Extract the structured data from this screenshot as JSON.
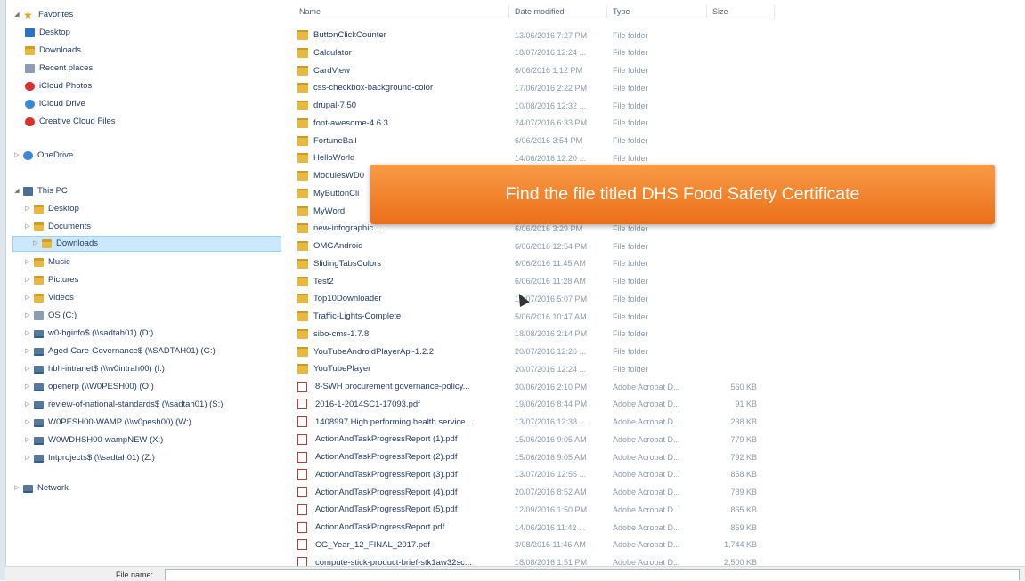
{
  "nav": {
    "favorites": "Favorites",
    "favorite_items": [
      "Desktop",
      "Downloads",
      "Recent places",
      "iCloud Photos",
      "iCloud Drive",
      "Creative Cloud Files"
    ],
    "onedrive": "OneDrive",
    "this_pc": "This PC",
    "pc_items": [
      "Desktop",
      "Documents",
      "Downloads",
      "Music",
      "Pictures",
      "Videos",
      "OS (C:)",
      "w0-bginfo$ (\\\\sadtah01) (D:)",
      "Aged-Care-Governance$ (\\\\SADTAH01) (G:)",
      "hbh-intranet$ (\\\\w0intrah00) (I:)",
      "openerp (\\\\W0PESH00) (O:)",
      "review-of-national-standards$ (\\\\sadtah01) (S:)",
      "W0PESH00-WAMP (\\\\w0pesh00) (W:)",
      "W0WDHSH00-wampNEW (X:)",
      "Intprojects$ (\\\\sadtah01) (Z:)"
    ],
    "network": "Network"
  },
  "columns": {
    "name": "Name",
    "date": "Date modified",
    "type": "Type",
    "size": "Size"
  },
  "files": [
    {
      "name": "ButtonClickCounter",
      "date": "13/06/2016 7:27 PM",
      "type": "File folder",
      "size": "",
      "kind": "folder"
    },
    {
      "name": "Calculator",
      "date": "18/07/2016 12:24 ...",
      "type": "File folder",
      "size": "",
      "kind": "folder"
    },
    {
      "name": "CardView",
      "date": "6/06/2016 1:12 PM",
      "type": "File folder",
      "size": "",
      "kind": "folder"
    },
    {
      "name": "css-checkbox-background-color",
      "date": "17/06/2016 2:22 PM",
      "type": "File folder",
      "size": "",
      "kind": "folder"
    },
    {
      "name": "drupal-7.50",
      "date": "10/08/2016 12:32 ...",
      "type": "File folder",
      "size": "",
      "kind": "folder"
    },
    {
      "name": "font-awesome-4.6.3",
      "date": "24/07/2016 6:33 PM",
      "type": "File folder",
      "size": "",
      "kind": "folder"
    },
    {
      "name": "FortuneBall",
      "date": "6/06/2016 3:54 PM",
      "type": "File folder",
      "size": "",
      "kind": "folder"
    },
    {
      "name": "HelloWorld",
      "date": "14/06/2016 12:20 ...",
      "type": "File folder",
      "size": "",
      "kind": "folder"
    },
    {
      "name": "ModulesWD0",
      "date": "",
      "type": "",
      "size": "",
      "kind": "folder"
    },
    {
      "name": "MyButtonCli",
      "date": "",
      "type": "",
      "size": "",
      "kind": "folder"
    },
    {
      "name": "MyWord",
      "date": "",
      "type": "",
      "size": "",
      "kind": "folder"
    },
    {
      "name": "new-infographic...",
      "date": "6/06/2016 3:29 PM",
      "type": "File folder",
      "size": "",
      "kind": "folder"
    },
    {
      "name": "OMGAndroid",
      "date": "6/06/2016 12:54 PM",
      "type": "File folder",
      "size": "",
      "kind": "folder"
    },
    {
      "name": "SlidingTabsColors",
      "date": "6/06/2016 11:45 AM",
      "type": "File folder",
      "size": "",
      "kind": "folder"
    },
    {
      "name": "Test2",
      "date": "6/06/2016 11:28 AM",
      "type": "File folder",
      "size": "",
      "kind": "folder"
    },
    {
      "name": "Top10Downloader",
      "date": "16/07/2016 5:07 PM",
      "type": "File folder",
      "size": "",
      "kind": "folder"
    },
    {
      "name": "Traffic-Lights-Complete",
      "date": "5/06/2016 10:47 AM",
      "type": "File folder",
      "size": "",
      "kind": "folder"
    },
    {
      "name": "sibo-cms-1.7.8",
      "date": "18/08/2016 2:14 PM",
      "type": "File folder",
      "size": "",
      "kind": "folder"
    },
    {
      "name": "YouTubeAndroidPlayerApi-1.2.2",
      "date": "20/07/2016 12:26 ...",
      "type": "File folder",
      "size": "",
      "kind": "folder"
    },
    {
      "name": "YouTubePlayer",
      "date": "20/07/2016 12:24 ...",
      "type": "File folder",
      "size": "",
      "kind": "folder"
    },
    {
      "name": "8-SWH procurement governance-policy...",
      "date": "30/06/2016 2:10 PM",
      "type": "Adobe Acrobat D...",
      "size": "560 KB",
      "kind": "pdf"
    },
    {
      "name": "2016-1-2014SC1-17093.pdf",
      "date": "19/06/2016 8:44 PM",
      "type": "Adobe Acrobat D...",
      "size": "91 KB",
      "kind": "pdf"
    },
    {
      "name": "1408997 High performing health service ...",
      "date": "13/07/2016 12:38 ...",
      "type": "Adobe Acrobat D...",
      "size": "238 KB",
      "kind": "pdf"
    },
    {
      "name": "ActionAndTaskProgressReport (1).pdf",
      "date": "15/06/2016 9:05 AM",
      "type": "Adobe Acrobat D...",
      "size": "779 KB",
      "kind": "pdf"
    },
    {
      "name": "ActionAndTaskProgressReport (2).pdf",
      "date": "15/06/2016 9:05 AM",
      "type": "Adobe Acrobat D...",
      "size": "792 KB",
      "kind": "pdf"
    },
    {
      "name": "ActionAndTaskProgressReport (3).pdf",
      "date": "13/07/2016 12:55 ...",
      "type": "Adobe Acrobat D...",
      "size": "858 KB",
      "kind": "pdf"
    },
    {
      "name": "ActionAndTaskProgressReport (4).pdf",
      "date": "20/07/2016 8:52 AM",
      "type": "Adobe Acrobat D...",
      "size": "789 KB",
      "kind": "pdf"
    },
    {
      "name": "ActionAndTaskProgressReport (5).pdf",
      "date": "12/09/2016 1:50 PM",
      "type": "Adobe Acrobat D...",
      "size": "865 KB",
      "kind": "pdf"
    },
    {
      "name": "ActionAndTaskProgressReport.pdf",
      "date": "14/06/2016 11:42 ...",
      "type": "Adobe Acrobat D...",
      "size": "869 KB",
      "kind": "pdf"
    },
    {
      "name": "CG_Year_12_FINAL_2017.pdf",
      "date": "3/08/2016 11:46 AM",
      "type": "Adobe Acrobat D...",
      "size": "1,744 KB",
      "kind": "pdf"
    },
    {
      "name": "compute-stick-product-brief-stk1aw32sc...",
      "date": "18/08/2016 1:51 PM",
      "type": "Adobe Acrobat D...",
      "size": "2,500 KB",
      "kind": "pdf"
    }
  ],
  "banner": "Find the file titled DHS Food Safety Certificate",
  "file_name_label": "File name:"
}
